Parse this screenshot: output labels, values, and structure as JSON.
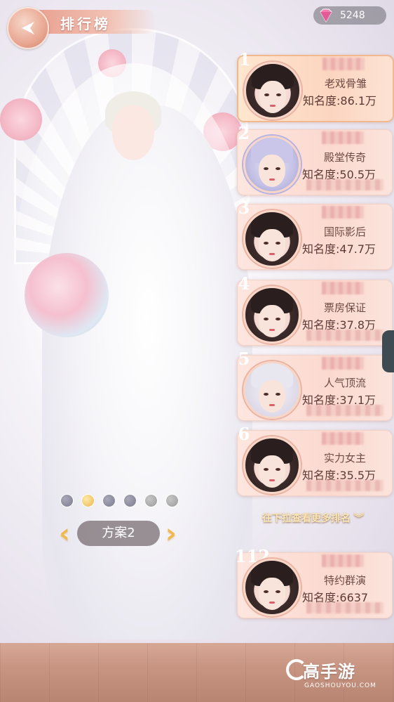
{
  "header": {
    "title": "排行榜",
    "currency_amount": "5248"
  },
  "scheme": {
    "label": "方案2",
    "dots": [
      "gray",
      "gold",
      "gray",
      "gray",
      "lightgray",
      "lightgray"
    ],
    "prev_icon": "chevron-left-icon",
    "next_icon": "chevron-right-icon"
  },
  "more_hint": "往下拉查看更多排名",
  "rankings": [
    {
      "rank": "1",
      "title": "老戏骨雏",
      "fame": "知名度:86.1万"
    },
    {
      "rank": "2",
      "title": "殿堂传奇",
      "fame": "知名度:50.5万"
    },
    {
      "rank": "3",
      "title": "国际影后",
      "fame": "知名度:47.7万"
    },
    {
      "rank": "4",
      "title": "票房保证",
      "fame": "知名度:37.8万"
    },
    {
      "rank": "5",
      "title": "人气顶流",
      "fame": "知名度:37.1万"
    },
    {
      "rank": "6",
      "title": "实力女主",
      "fame": "知名度:35.5万"
    }
  ],
  "my_rank": {
    "rank": "112",
    "title": "特约群演",
    "fame": "知名度:6637"
  },
  "watermark": {
    "main": "高手游",
    "sub": "GAOSHOUYOU.COM"
  },
  "colors": {
    "accent": "#e9a292",
    "gold": "#f1b84d",
    "card_bg": "#fde6df"
  }
}
